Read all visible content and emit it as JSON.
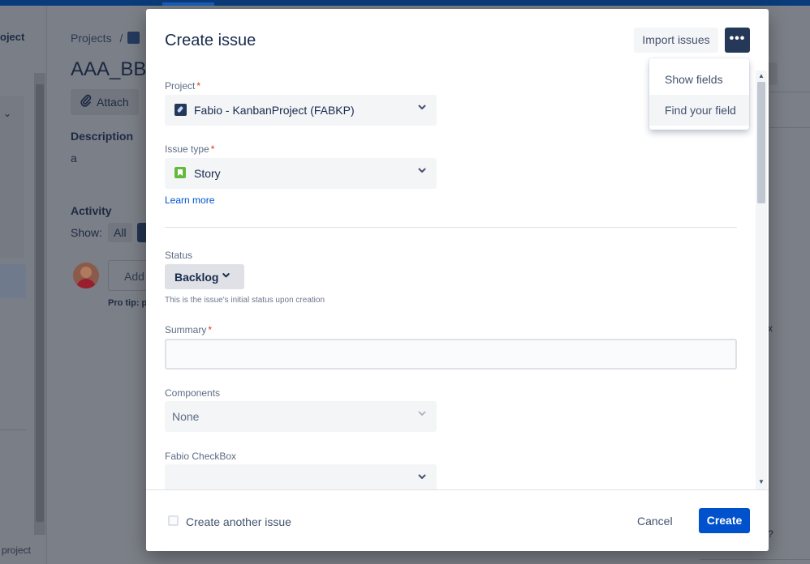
{
  "background": {
    "sidebar_project_label": "oject",
    "sidebar_footer": "project",
    "breadcrumb": "Projects",
    "breadcrumb_sep": "/",
    "issue_title": "AAA_BBB",
    "attach_label": "Attach",
    "description_label": "Description",
    "description_value": "a",
    "activity_label": "Activity",
    "show_label": "Show:",
    "all_label": "All",
    "add_comment_placeholder": "Add",
    "pro_tip": "Pro tip: p",
    "right_x": "x",
    "right_q": "?"
  },
  "modal": {
    "title": "Create issue",
    "import_label": "Import issues",
    "more_label": "•••",
    "menu": {
      "items": [
        "Show fields",
        "Find your field"
      ]
    },
    "project": {
      "label": "Project",
      "value": "Fabio - KanbanProject (FABKP)"
    },
    "issue_type": {
      "label": "Issue type",
      "value": "Story",
      "learn_more": "Learn more"
    },
    "status": {
      "label": "Status",
      "value": "Backlog",
      "help": "This is the issue's initial status upon creation"
    },
    "summary": {
      "label": "Summary",
      "value": ""
    },
    "components": {
      "label": "Components",
      "value": "None"
    },
    "fabio_checkbox": {
      "label": "Fabio CheckBox",
      "value": ""
    },
    "required_mark": "*",
    "footer": {
      "create_another_label": "Create another issue",
      "cancel_label": "Cancel",
      "create_label": "Create"
    }
  },
  "colors": {
    "primary": "#0052cc",
    "dark_button": "#253858",
    "required": "#de350b",
    "story_green": "#63ba3c"
  }
}
